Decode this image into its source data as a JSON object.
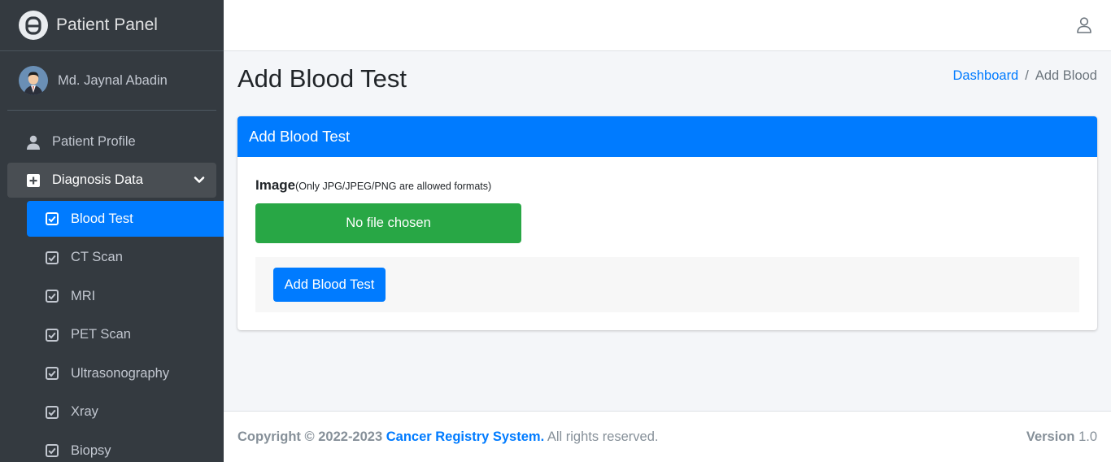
{
  "sidebar": {
    "brand": "Patient Panel",
    "user_name": "Md. Jaynal Abadin",
    "nav": [
      {
        "label": "Patient Profile"
      },
      {
        "label": "Diagnosis Data"
      }
    ],
    "sub_items": [
      {
        "label": "Blood Test"
      },
      {
        "label": "CT Scan"
      },
      {
        "label": "MRI"
      },
      {
        "label": "PET Scan"
      },
      {
        "label": "Ultrasonography"
      },
      {
        "label": "Xray"
      },
      {
        "label": "Biopsy"
      }
    ]
  },
  "header": {
    "title": "Add Blood Test",
    "breadcrumb": {
      "home": "Dashboard",
      "separator": "/",
      "current": "Add Blood"
    }
  },
  "card": {
    "title": "Add Blood Test",
    "field_label": "Image",
    "field_hint": "(Only JPG/JPEG/PNG are allowed formats)",
    "file_status": "No file chosen",
    "submit_label": "Add Blood Test"
  },
  "footer": {
    "copyright_prefix": "Copyright © 2022-2023",
    "org": "Cancer Registry System.",
    "rights": " All rights reserved.",
    "version_label": "Version",
    "version_value": "1.0"
  },
  "colors": {
    "primary": "#007bff",
    "success": "#28a745",
    "sidebar_bg": "#343a40"
  }
}
